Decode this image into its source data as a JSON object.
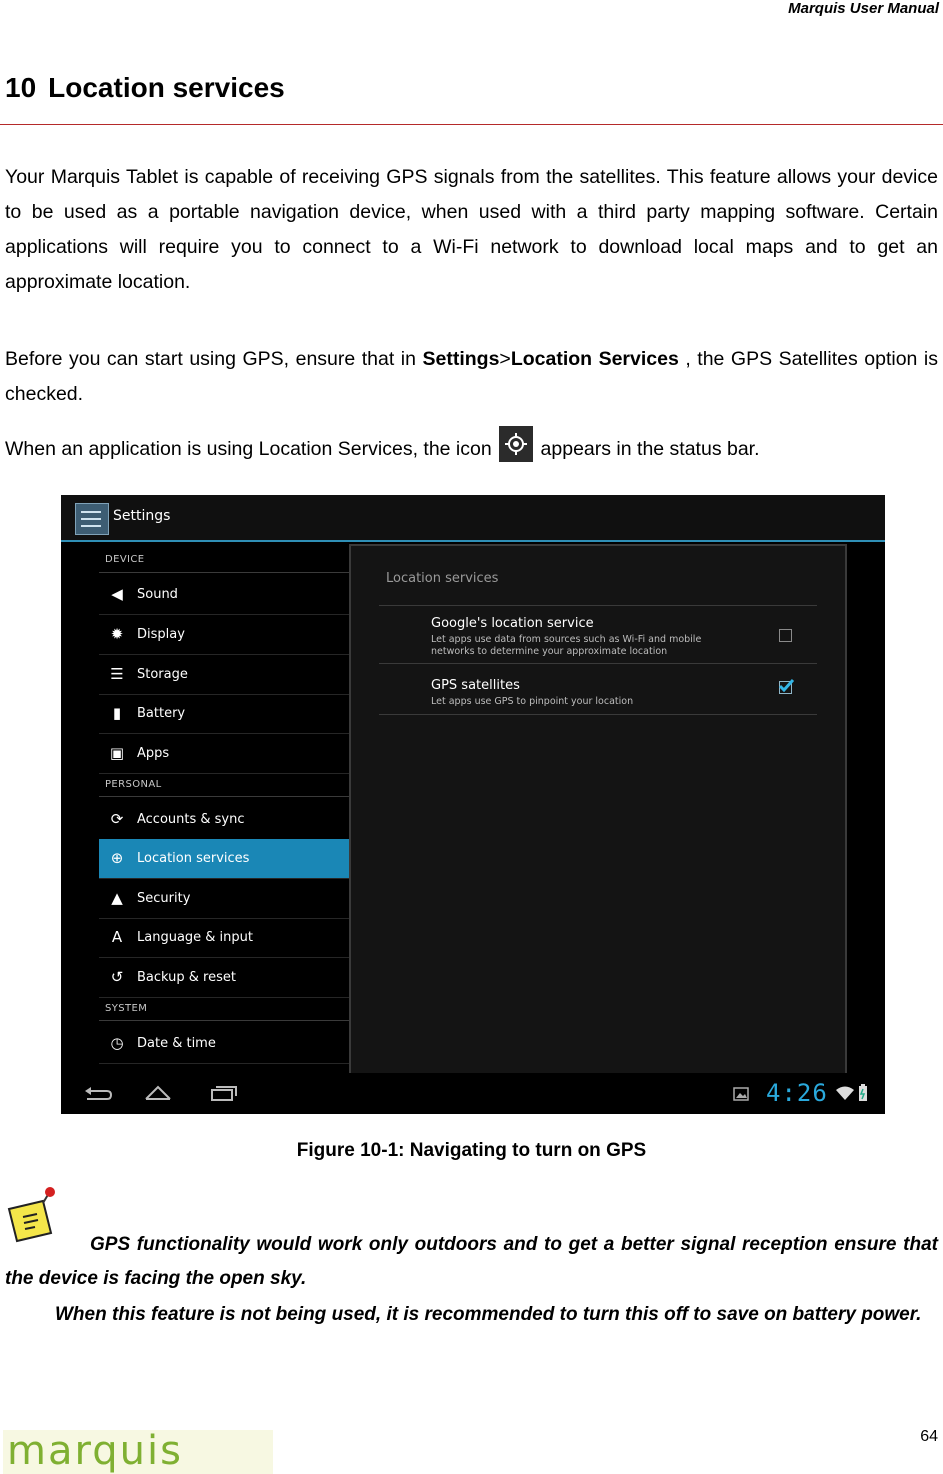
{
  "header": {
    "title": "Marquis User Manual"
  },
  "chapter": {
    "number": "10",
    "title": "Location services"
  },
  "paragraphs": {
    "p1": "Your Marquis Tablet is capable of receiving GPS signals from the satellites.  This feature allows your device to be used as a portable navigation device, when used with a third party mapping software. Certain applications will require you to connect to a Wi-Fi network to download local maps and to get an approximate location.",
    "p2_before": "Before you can start using GPS, ensure that in ",
    "p2_settings": "Settings",
    "p2_sep": ">",
    "p2_location": "Location Services",
    "p2_after": " , the  GPS Satellites option is checked.",
    "p3_before": "When an application is using Location Services, the icon ",
    "p3_after": " appears in the status bar."
  },
  "screenshot": {
    "app_title": "Settings",
    "sections": {
      "device": "DEVICE",
      "personal": "PERSONAL",
      "system": "SYSTEM"
    },
    "items": [
      {
        "label": "Sound",
        "icon": "speaker-icon"
      },
      {
        "label": "Display",
        "icon": "brightness-icon"
      },
      {
        "label": "Storage",
        "icon": "storage-icon"
      },
      {
        "label": "Battery",
        "icon": "battery-icon"
      },
      {
        "label": "Apps",
        "icon": "apps-icon"
      },
      {
        "label": "Accounts & sync",
        "icon": "sync-icon"
      },
      {
        "label": "Location services",
        "icon": "location-icon",
        "selected": true
      },
      {
        "label": "Security",
        "icon": "lock-icon"
      },
      {
        "label": "Language & input",
        "icon": "language-icon"
      },
      {
        "label": "Backup & reset",
        "icon": "backup-icon"
      },
      {
        "label": "Date & time",
        "icon": "clock-icon"
      }
    ],
    "panel_title": "Location services",
    "options": [
      {
        "title": "Google's location service",
        "subtitle": "Let apps use data from sources such as Wi-Fi and mobile networks to determine your approximate location",
        "checked": false
      },
      {
        "title": "GPS satellites",
        "subtitle": "Let apps use GPS to pinpoint your location",
        "checked": true
      }
    ],
    "clock": "4:26",
    "accent_color": "#1a87b6"
  },
  "caption": "Figure 10-1: Navigating to turn on GPS",
  "notes": {
    "n1": "GPS functionality would work only outdoors and to get a better signal reception ensure that the device is facing the open sky.",
    "n2": "When this feature is not being used, it is recommended to turn this off to save on battery power."
  },
  "footer": {
    "page_number": "64",
    "logo_text": "marquis"
  }
}
